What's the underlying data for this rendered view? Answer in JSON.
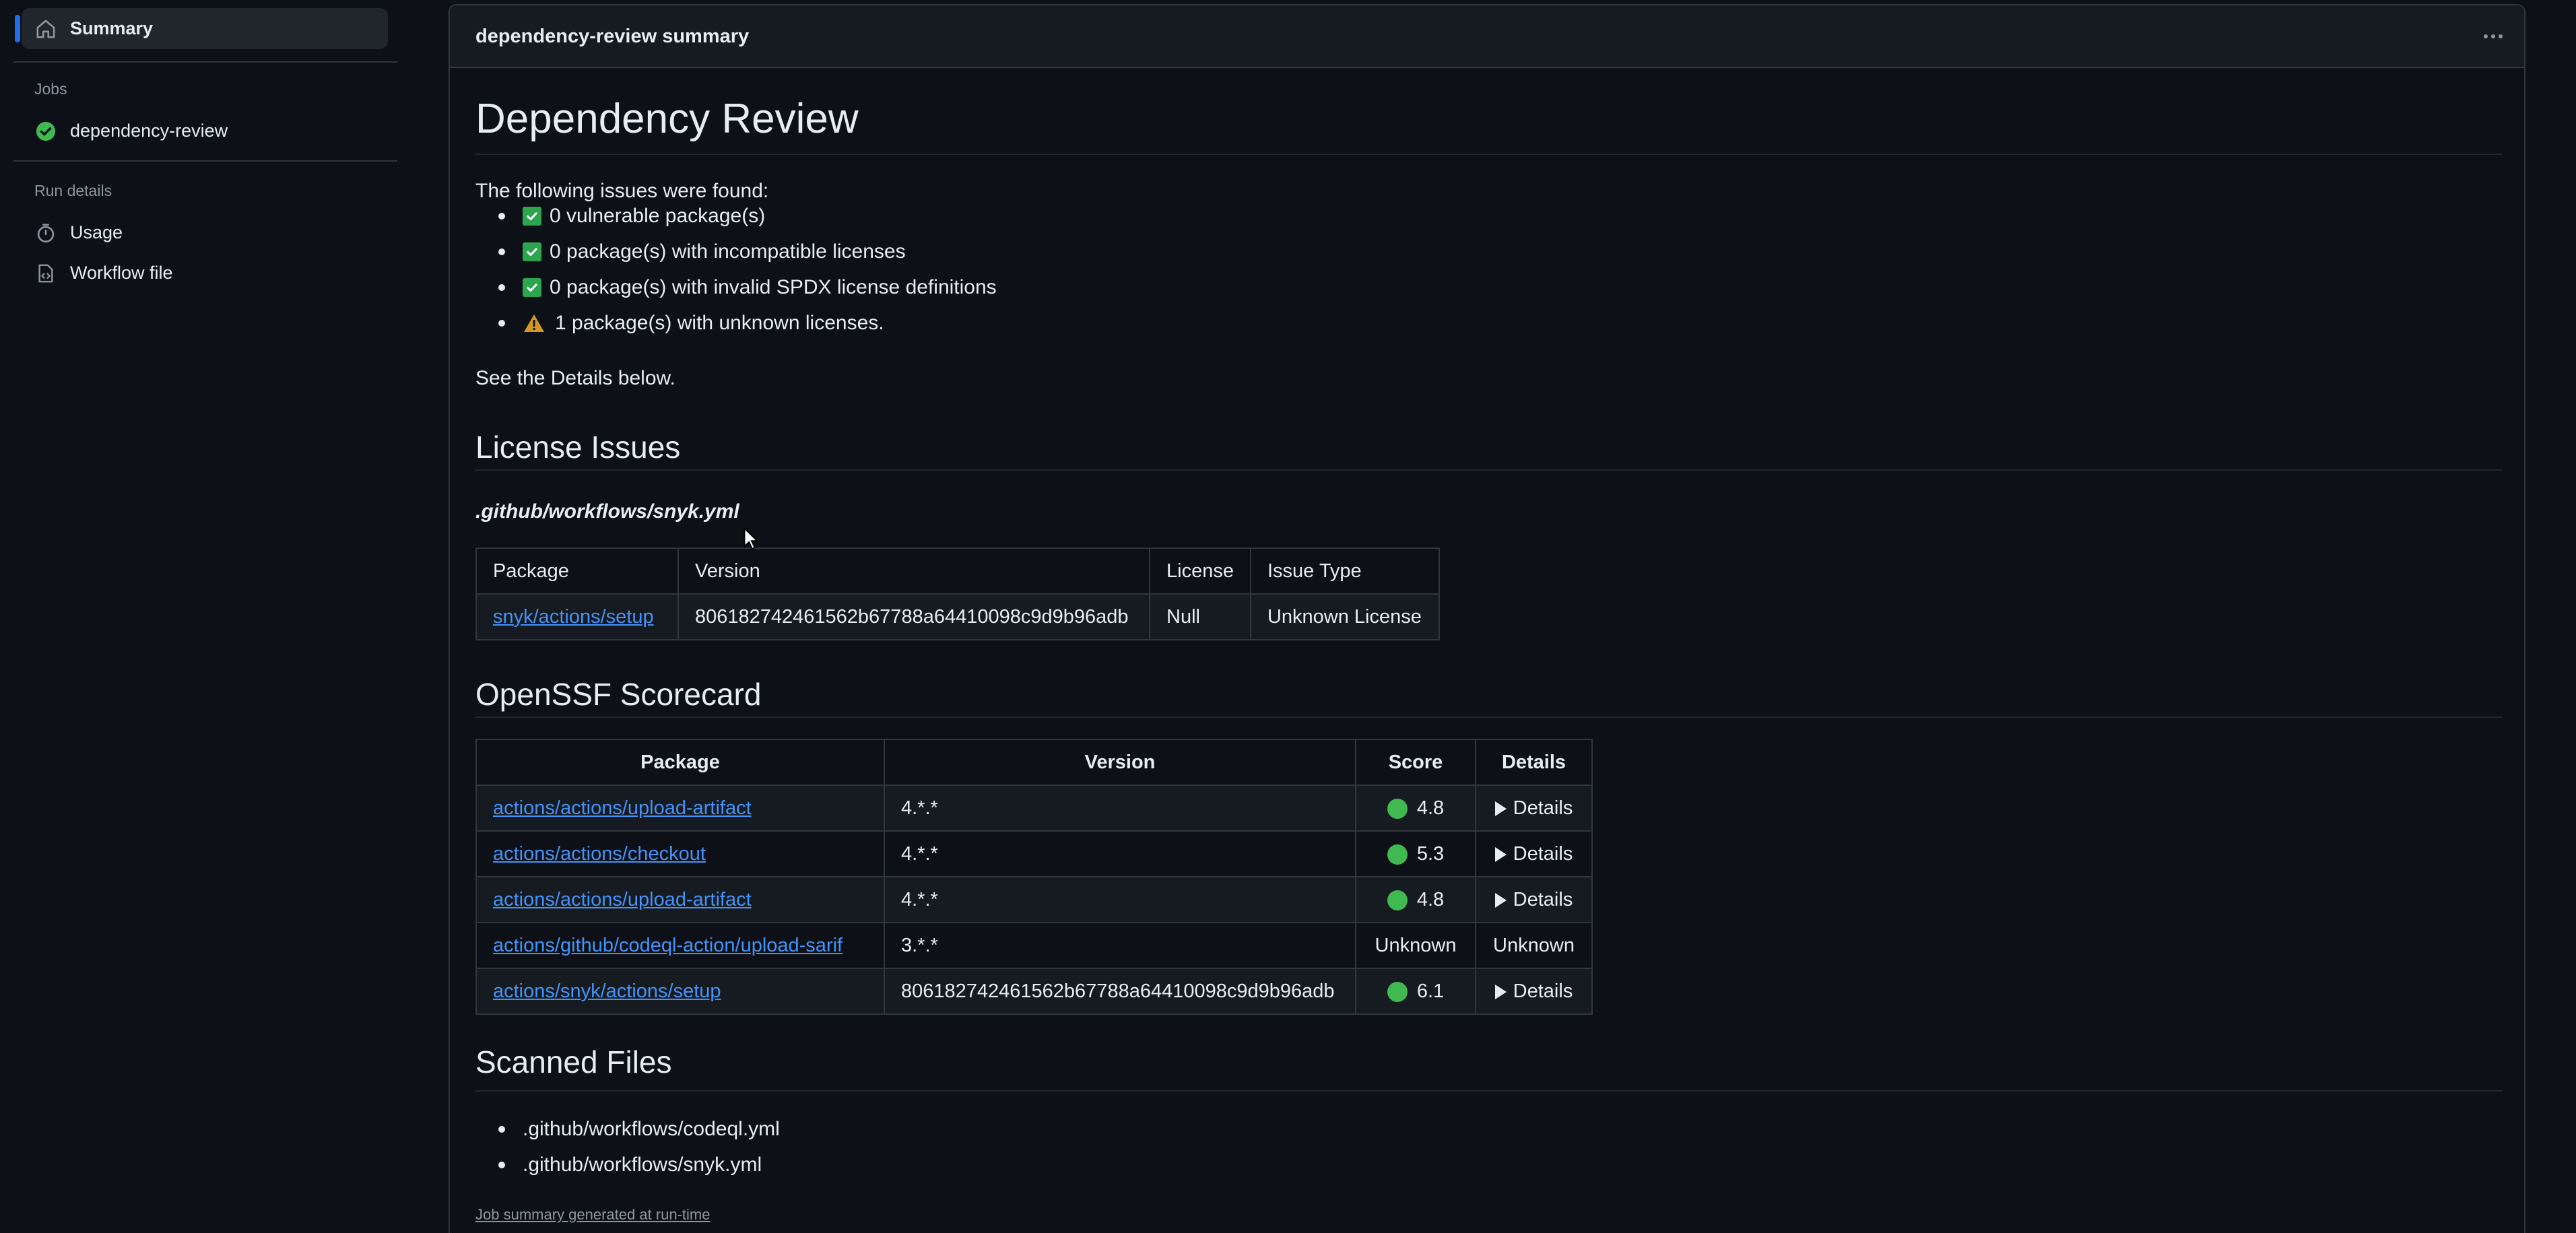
{
  "sidebar": {
    "summary_label": "Summary",
    "jobs_heading": "Jobs",
    "job_label": "dependency-review",
    "run_details_heading": "Run details",
    "usage_label": "Usage",
    "workflow_file_label": "Workflow file"
  },
  "panel": {
    "title": "dependency-review summary",
    "heading": "Dependency Review",
    "intro": "The following issues were found:",
    "issues": [
      {
        "status": "ok",
        "text": "0 vulnerable package(s)"
      },
      {
        "status": "ok",
        "text": "0 package(s) with incompatible licenses"
      },
      {
        "status": "ok",
        "text": "0 package(s) with invalid SPDX license definitions"
      },
      {
        "status": "warning",
        "text": "1 package(s) with unknown licenses."
      }
    ],
    "see_details": "See the Details below."
  },
  "license_issues": {
    "heading": "License Issues",
    "file": ".github/workflows/snyk.yml",
    "columns": [
      "Package",
      "Version",
      "License",
      "Issue Type"
    ],
    "rows": [
      {
        "package": "snyk/actions/setup",
        "version": "806182742461562b67788a64410098c9d9b96adb",
        "license": "Null",
        "issue_type": "Unknown License"
      }
    ]
  },
  "scorecard": {
    "heading": "OpenSSF Scorecard",
    "columns": [
      "Package",
      "Version",
      "Score",
      "Details"
    ],
    "rows": [
      {
        "package": "actions/actions/upload-artifact",
        "version": "4.*.*",
        "score": "4.8",
        "details": "Details"
      },
      {
        "package": "actions/actions/checkout",
        "version": "4.*.*",
        "score": "5.3",
        "details": "Details"
      },
      {
        "package": "actions/actions/upload-artifact",
        "version": "4.*.*",
        "score": "4.8",
        "details": "Details"
      },
      {
        "package": "actions/github/codeql-action/upload-sarif",
        "version": "3.*.*",
        "score": "Unknown",
        "details": "Unknown"
      },
      {
        "package": "actions/snyk/actions/setup",
        "version": "806182742461562b67788a64410098c9d9b96adb",
        "score": "6.1",
        "details": "Details"
      }
    ]
  },
  "scanned_files": {
    "heading": "Scanned Files",
    "files": [
      ".github/workflows/codeql.yml",
      ".github/workflows/snyk.yml"
    ]
  },
  "footer": {
    "note": "Job summary generated at run-time"
  },
  "colors": {
    "accent": "#1f6feb",
    "success": "#2da44e",
    "score_green": "#3fb950",
    "warning": "#d29922",
    "link": "#4493f8"
  }
}
